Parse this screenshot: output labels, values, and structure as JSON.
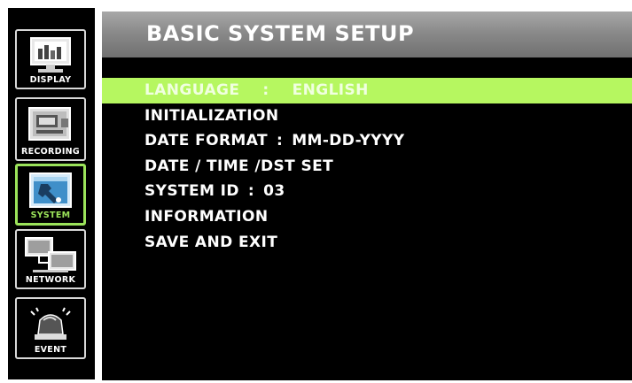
{
  "sidebar": {
    "items": [
      {
        "label": "DISPLAY",
        "icon": "monitor-icon",
        "active": false
      },
      {
        "label": "RECORDING",
        "icon": "camera-icon",
        "active": false
      },
      {
        "label": "SYSTEM",
        "icon": "wrench-icon",
        "active": true
      },
      {
        "label": "NETWORK",
        "icon": "network-icon",
        "active": false
      },
      {
        "label": "EVENT",
        "icon": "alarm-icon",
        "active": false
      }
    ]
  },
  "header": {
    "title": "BASIC SYSTEM SETUP"
  },
  "menu": {
    "items": [
      {
        "label": "LANGUAGE",
        "separator": ":",
        "value": "ENGLISH",
        "selected": true
      },
      {
        "label": "INITIALIZATION"
      },
      {
        "label": "DATE FORMAT",
        "separator": ":",
        "value": "MM-DD-YYYY"
      },
      {
        "label": "DATE / TIME /DST SET"
      },
      {
        "label": "SYSTEM ID",
        "separator": ":",
        "value": "03"
      },
      {
        "label": "INFORMATION"
      },
      {
        "label": "SAVE AND EXIT"
      }
    ]
  },
  "colors": {
    "highlight": "#b6f760",
    "active_nav": "#9be35a",
    "title_bar": "#8a8a8a",
    "background": "#000000"
  }
}
